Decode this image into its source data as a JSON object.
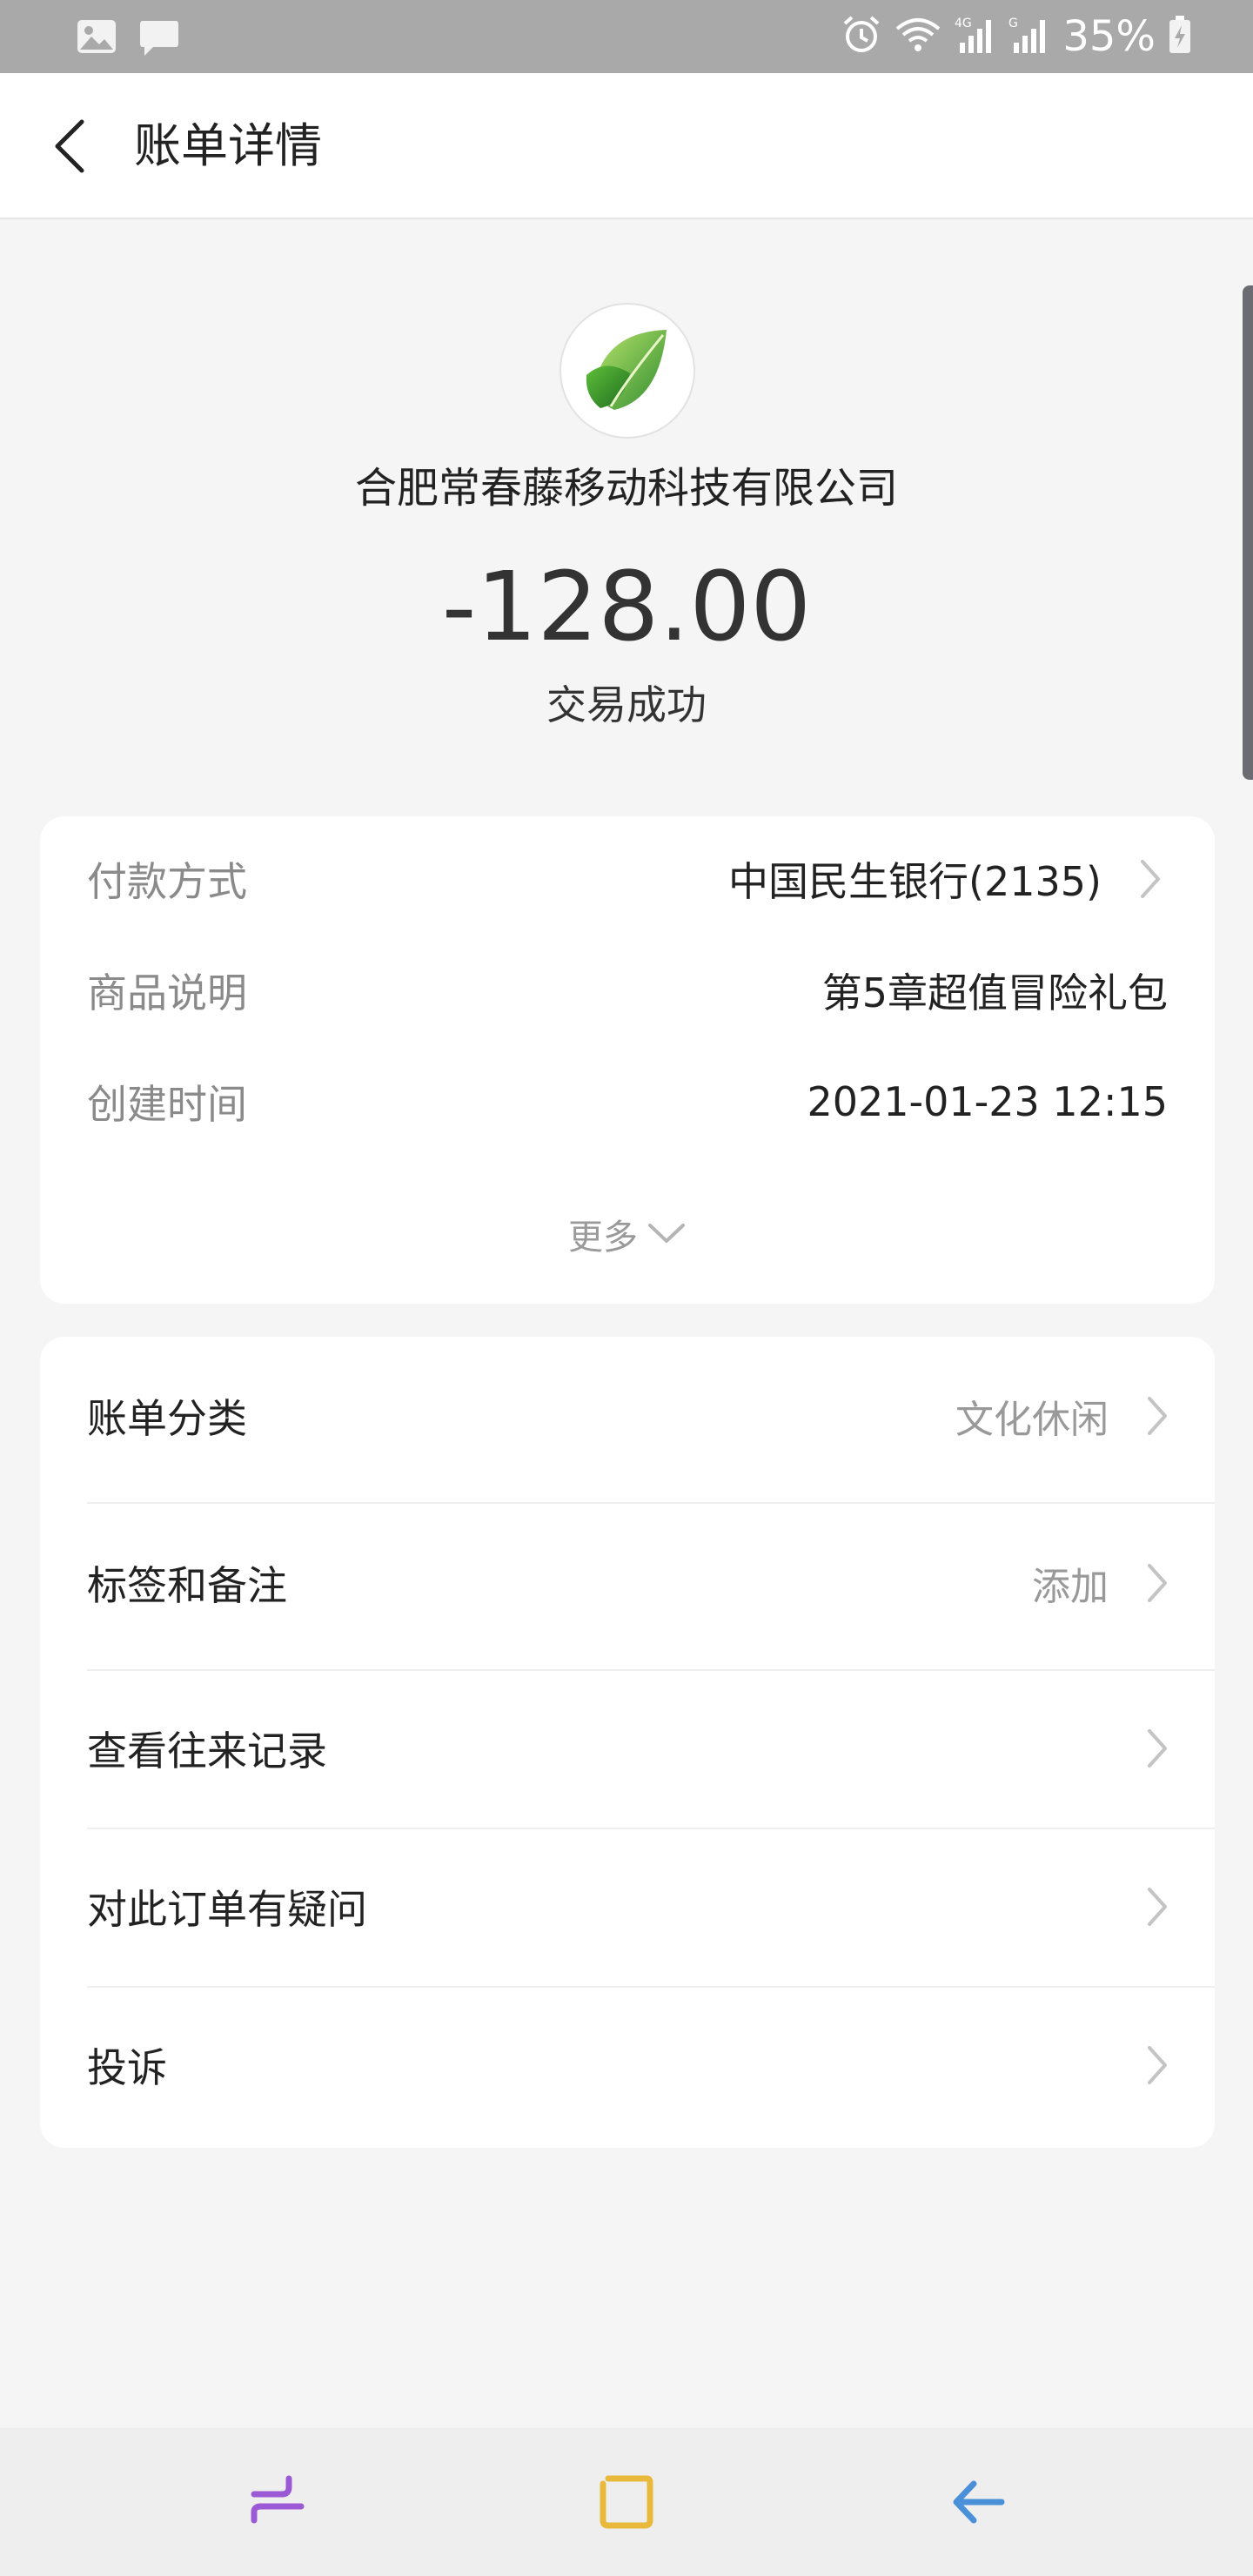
{
  "status_bar": {
    "battery_percent": "35%",
    "icons": [
      "image-icon",
      "message-icon",
      "alarm-icon",
      "wifi-icon",
      "signal-4g-icon",
      "signal-icon",
      "battery-charging-icon"
    ]
  },
  "header": {
    "title": "账单详情"
  },
  "summary": {
    "merchant_name": "合肥常春藤移动科技有限公司",
    "amount": "-128.00",
    "status": "交易成功",
    "logo_icon": "green-leaf-logo"
  },
  "details": {
    "rows": [
      {
        "label": "付款方式",
        "value": "中国民生银行(2135)"
      },
      {
        "label": "商品说明",
        "value": "第5章超值冒险礼包"
      },
      {
        "label": "创建时间",
        "value": "2021-01-23 12:15"
      }
    ],
    "more_label": "更多"
  },
  "menu": {
    "items": [
      {
        "label": "账单分类",
        "value": "文化休闲"
      },
      {
        "label": "标签和备注",
        "value": "添加"
      },
      {
        "label": "查看往来记录",
        "value": ""
      },
      {
        "label": "对此订单有疑问",
        "value": ""
      },
      {
        "label": "投诉",
        "value": ""
      }
    ]
  },
  "colors": {
    "accent_green": "#4caf50",
    "nav_recent": "#9b59d6",
    "nav_home": "#e8b93a",
    "nav_back": "#4a90d9"
  }
}
